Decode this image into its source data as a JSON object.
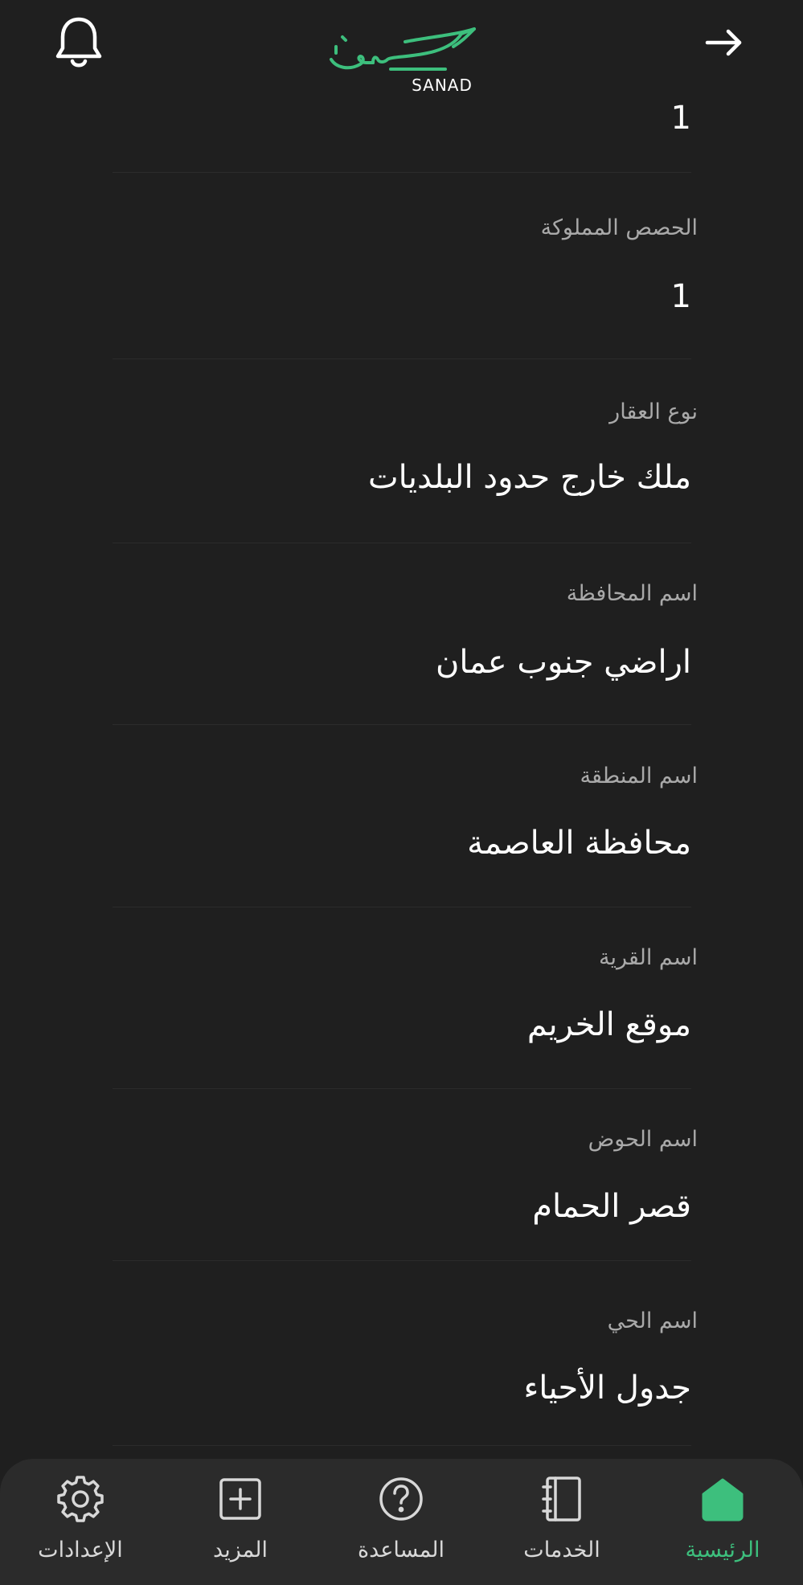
{
  "header": {
    "brand_text": "SANAD",
    "logo_arabic": "سند",
    "accent_color": "#3dbf7d"
  },
  "details": {
    "partial_value": "1",
    "items": [
      {
        "label": "الحصص المملوكة",
        "value": "1"
      },
      {
        "label": "نوع العقار",
        "value": "ملك خارج حدود البلديات"
      },
      {
        "label": "اسم المحافظة",
        "value": "اراضي جنوب عمان"
      },
      {
        "label": "اسم المنطقة",
        "value": "محافظة العاصمة"
      },
      {
        "label": "اسم القرية",
        "value": "موقع الخريم"
      },
      {
        "label": "اسم الحوض",
        "value": "قصر الحمام"
      },
      {
        "label": "اسم الحي",
        "value": "جدول الأحياء"
      }
    ]
  },
  "bottom_nav": {
    "items": [
      {
        "label": "الإعدادات",
        "icon": "gear-icon"
      },
      {
        "label": "المزيد",
        "icon": "plus-square-icon"
      },
      {
        "label": "المساعدة",
        "icon": "help-circle-icon"
      },
      {
        "label": "الخدمات",
        "icon": "notebook-icon"
      },
      {
        "label": "الرئيسية",
        "icon": "home-icon",
        "active": true
      }
    ]
  }
}
